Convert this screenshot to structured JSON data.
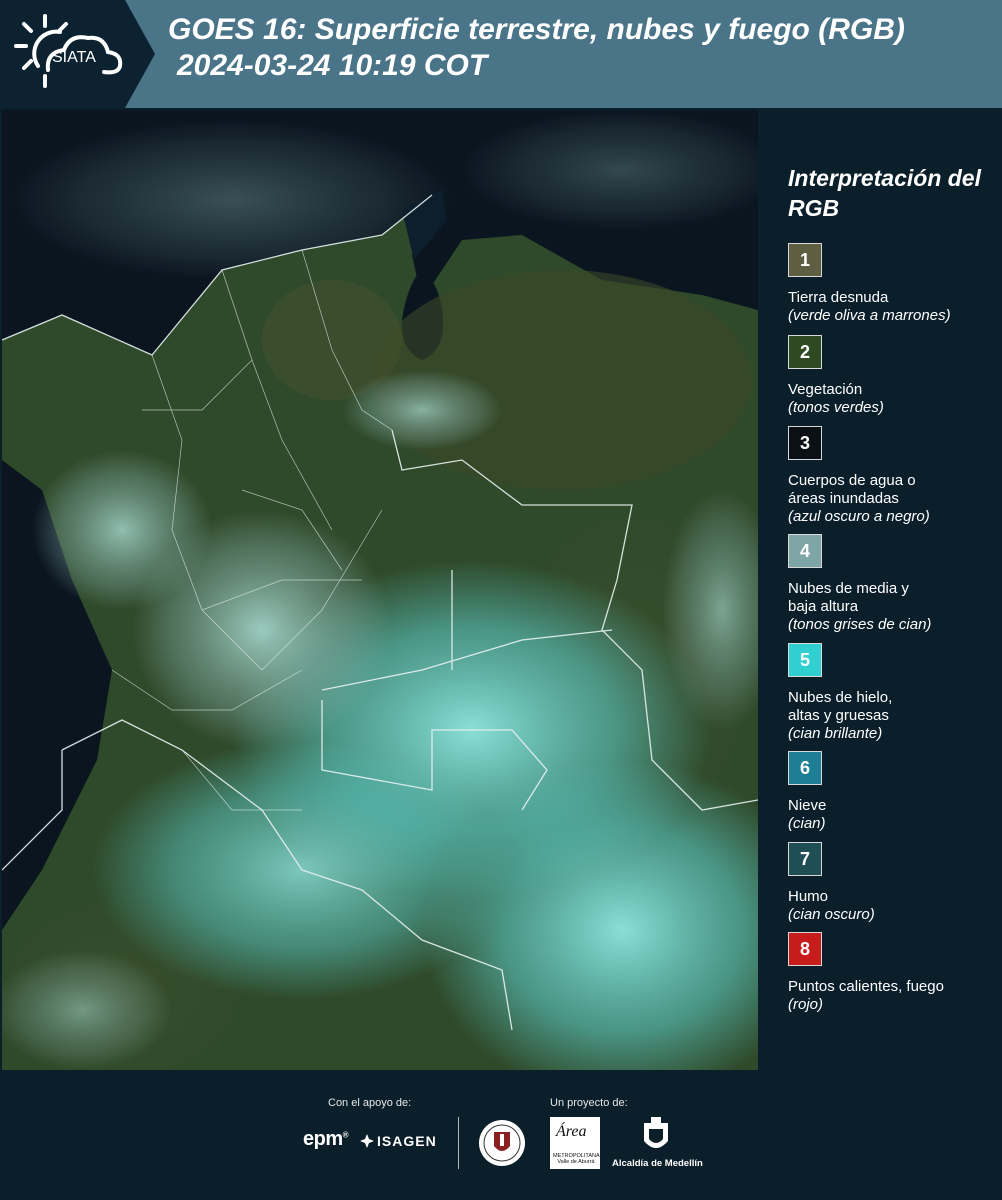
{
  "header": {
    "logo_text": "SIATA",
    "title_line1": "GOES 16: Superficie terrestre, nubes y fuego (RGB)",
    "title_line2": "2024-03-24 10:19 COT"
  },
  "legend": {
    "title": "Interpretación del RGB",
    "items": [
      {
        "number": "1",
        "label": "Tierra desnuda",
        "note": "(verde oliva a marrones)",
        "color": "#5f5e42"
      },
      {
        "number": "2",
        "label": "Vegetación",
        "note": "(tonos verdes)",
        "color": "#2f4a22"
      },
      {
        "number": "3",
        "label": "Cuerpos de agua o áreas inundadas",
        "note": "(azul oscuro a negro)",
        "color": "#0b1016"
      },
      {
        "number": "4",
        "label": "Nubes de media y baja altura",
        "note": "(tonos grises de cian)",
        "color": "#7fa6a7"
      },
      {
        "number": "5",
        "label": "Nubes de hielo, altas y gruesas",
        "note": "(cian brillante)",
        "color": "#2fd0cf"
      },
      {
        "number": "6",
        "label": "Nieve",
        "note": "(cian)",
        "color": "#1d7f93"
      },
      {
        "number": "7",
        "label": "Humo",
        "note": "(cian oscuro)",
        "color": "#1f4f55"
      },
      {
        "number": "8",
        "label": "Puntos calientes, fuego",
        "note": "(rojo)",
        "color": "#c71c1c"
      }
    ]
  },
  "footer": {
    "support_label": "Con el apoyo de:",
    "project_label": "Un proyecto de:",
    "epm": "epm",
    "isagen": "ISAGEN",
    "area_logo_word": "Área",
    "area_logo_sub": "METROPOLITANA Valle de Aburrá",
    "alcaldia": "Alcaldía de Medellín"
  },
  "colors": {
    "header_bg": "#4a7487",
    "panel_bg": "#0b1f2b",
    "ocean": "#0a1520",
    "land": "#2d4a2c",
    "cloud": "#6fd6d0"
  },
  "icons": [
    "siata-sun-cloud-icon",
    "isagen-mark-icon",
    "university-seal-icon",
    "medellin-coat-of-arms-icon"
  ]
}
